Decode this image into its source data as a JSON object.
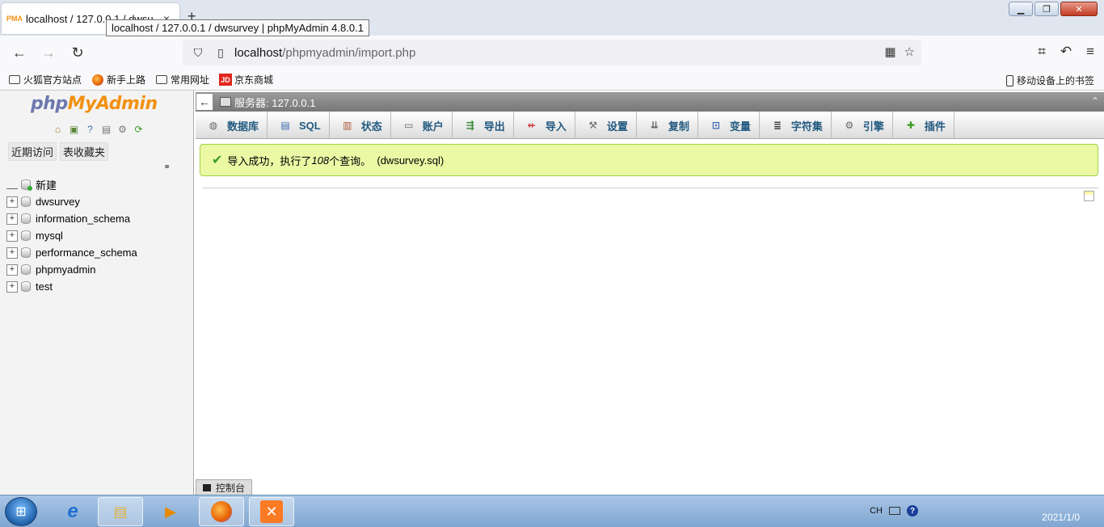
{
  "browser": {
    "tab_title": "localhost / 127.0.0.1 / dwsu",
    "tab_close": "×",
    "new_tab": "+",
    "tooltip": "localhost / 127.0.0.1 / dwsurvey | phpMyAdmin 4.8.0.1",
    "url_host": "localhost",
    "url_path": "/phpmyadmin/import.php",
    "win_minimize": "▁",
    "win_restore": "❐",
    "win_close": "✕"
  },
  "bookmarks": [
    {
      "label": "火狐官方站点",
      "icon": "folder-icon"
    },
    {
      "label": "新手上路",
      "icon": "firefox-icon"
    },
    {
      "label": "常用网址",
      "icon": "folder-icon"
    },
    {
      "label": "京东商城",
      "icon": "jd-icon"
    }
  ],
  "bookmarks_mobile": "移动设备上的书签",
  "sidebar": {
    "logo_part1": "php",
    "logo_part2": "MyAdmin",
    "tab_recent": "近期访问",
    "tab_favorites": "表收藏夹",
    "tree_new": "新建",
    "databases": [
      "dwsurvey",
      "information_schema",
      "mysql",
      "performance_schema",
      "phpmyadmin",
      "test"
    ]
  },
  "server_bar": {
    "label": "服务器: 127.0.0.1"
  },
  "menu": [
    {
      "label": "数据库",
      "icon": "database-icon"
    },
    {
      "label": "SQL",
      "icon": "sql-icon"
    },
    {
      "label": "状态",
      "icon": "status-icon"
    },
    {
      "label": "账户",
      "icon": "accounts-icon"
    },
    {
      "label": "导出",
      "icon": "export-icon"
    },
    {
      "label": "导入",
      "icon": "import-icon"
    },
    {
      "label": "设置",
      "icon": "wrench-icon"
    },
    {
      "label": "复制",
      "icon": "replication-icon"
    },
    {
      "label": "变量",
      "icon": "variables-icon"
    },
    {
      "label": "字符集",
      "icon": "charset-icon"
    },
    {
      "label": "引擎",
      "icon": "engine-icon"
    },
    {
      "label": "插件",
      "icon": "plugin-icon"
    }
  ],
  "message": {
    "prefix": "导入成功，执行了 ",
    "count": "108",
    "suffix": " 个查询。",
    "file": "(dwsurvey.sql)"
  },
  "console": {
    "label": "控制台"
  },
  "taskbar": {
    "tray_lang": "CH",
    "tray_help": "?",
    "clock": "2021/1/0"
  }
}
